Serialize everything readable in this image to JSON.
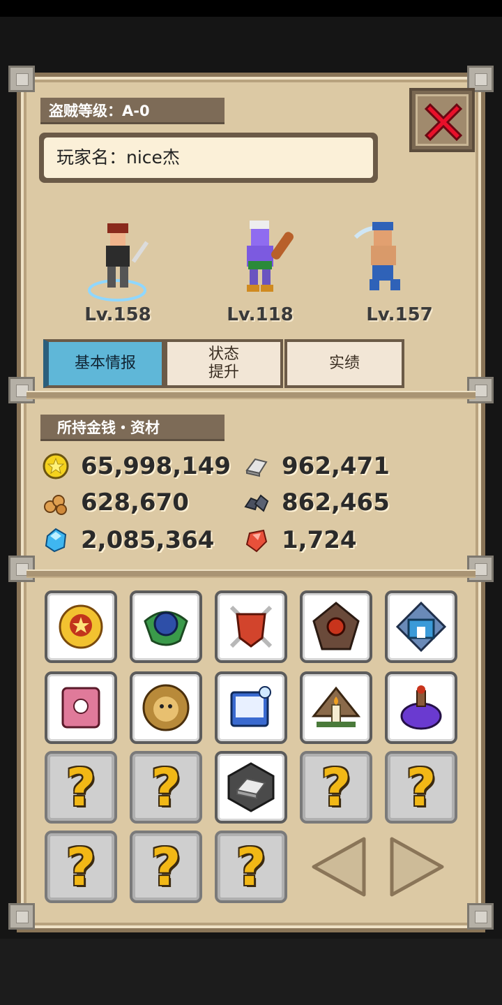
{
  "header": {
    "thief_level": "盗贼等级：A-0",
    "player_name": "玩家名：nice杰"
  },
  "heroes": [
    {
      "level": "Lv.158"
    },
    {
      "level": "Lv.118"
    },
    {
      "level": "Lv.157"
    }
  ],
  "tabs": [
    {
      "label": "基本情报",
      "active": true
    },
    {
      "label_line1": "状态",
      "label_line2": "提升"
    },
    {
      "label": "实绩"
    }
  ],
  "resources": {
    "title": "所持金钱・资材",
    "gold": "65,998,149",
    "silver": "962,471",
    "wood": "628,670",
    "ore": "862,465",
    "crystal": "2,085,364",
    "ruby": "1,724"
  },
  "grid": {
    "unlocked_icons": [
      "gold-medal-icon",
      "green-orb-emblem-icon",
      "red-shield-swords-icon",
      "dark-gem-emblem-icon",
      "blue-castle-emblem-icon",
      "pink-book-icon",
      "lion-head-icon",
      "blue-book-icon",
      "candle-shrine-icon",
      "purple-potion-icon",
      "silver-ingot-icon"
    ],
    "locked_symbol": "?"
  },
  "colors": {
    "parchment": "#dcc9a4",
    "header_bg": "#7d6b57",
    "tab_active": "#5fb7d8",
    "close_x": "#e8102a",
    "question_mark": "#f2b816"
  }
}
